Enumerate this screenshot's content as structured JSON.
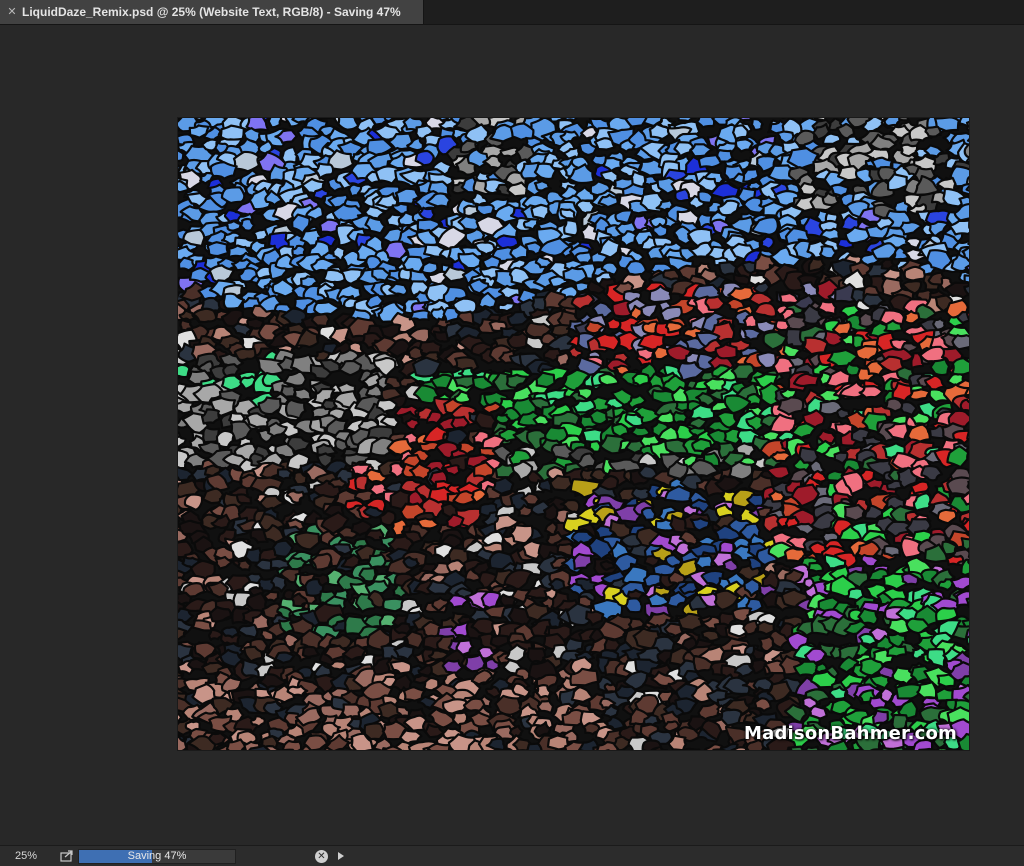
{
  "document": {
    "tab_title": "LiquidDaze_Remix.psd @ 25% (Website Text, RGB/8) - Saving 47%",
    "close_icon": "close-icon"
  },
  "canvas": {
    "watermark": "MadisonBahmer.com",
    "palette": {
      "sky": [
        "#6aaaf0",
        "#5b9be6",
        "#8fc1f5",
        "#3f7ee0",
        "#2a44e0",
        "#7f73f2",
        "#d8d8e6",
        "#b8c8d8",
        "#1c2fd8"
      ],
      "grey": [
        "#5a5a5a",
        "#808080",
        "#a8a8a8",
        "#c8c8c8",
        "#3c3c3c"
      ],
      "green": [
        "#1fa03a",
        "#2ccf4a",
        "#49e05e",
        "#198a34",
        "#2b6f3a",
        "#3ddc86"
      ],
      "red": [
        "#d72525",
        "#c4452a",
        "#e56a3a",
        "#9e1b2a",
        "#f07080",
        "#b83030"
      ],
      "dark": [
        "#1a1212",
        "#2a1a18",
        "#3d2a22",
        "#4a2f28",
        "#5e3a32",
        "#2a3340",
        "#1c2430"
      ],
      "brown": [
        "#9a6a60",
        "#b88476",
        "#7a4e44",
        "#c89488"
      ],
      "purple": [
        "#a14ad0",
        "#7f3fa8",
        "#c070d8"
      ],
      "blue": [
        "#2e5aa0",
        "#3a78c0",
        "#1f4280"
      ],
      "yellow": [
        "#d8d020",
        "#b8a018"
      ]
    }
  },
  "status": {
    "zoom": "25%",
    "progress_label": "Saving 47%",
    "progress_value": 0.47
  }
}
